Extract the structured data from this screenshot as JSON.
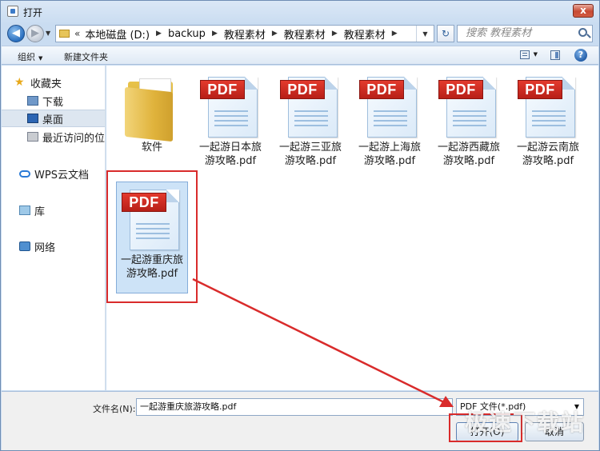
{
  "window": {
    "title": "打开",
    "close_label": "x"
  },
  "address": {
    "overflow": "«",
    "crumbs": [
      "本地磁盘 (D:)",
      "backup",
      "教程素材",
      "教程素材",
      "教程素材"
    ],
    "refresh_label": "↻"
  },
  "search": {
    "placeholder": "搜索 教程素材"
  },
  "toolbar": {
    "organize": "组织",
    "new_folder": "新建文件夹",
    "help": "?"
  },
  "sidebar": {
    "items": [
      {
        "label": "收藏夹",
        "icon": "star-icon"
      },
      {
        "label": "下载",
        "icon": "download-folder-icon"
      },
      {
        "label": "桌面",
        "icon": "desktop-icon"
      },
      {
        "label": "最近访问的位置",
        "icon": "recent-places-icon"
      },
      {
        "label": "WPS云文档",
        "icon": "cloud-icon"
      },
      {
        "label": "库",
        "icon": "library-icon"
      },
      {
        "label": "网络",
        "icon": "network-icon"
      }
    ]
  },
  "files": [
    {
      "name": "软件",
      "type": "folder"
    },
    {
      "name": "一起游日本旅游攻略.pdf",
      "type": "pdf"
    },
    {
      "name": "一起游三亚旅游攻略.pdf",
      "type": "pdf"
    },
    {
      "name": "一起游上海旅游攻略.pdf",
      "type": "pdf"
    },
    {
      "name": "一起游西藏旅游攻略.pdf",
      "type": "pdf"
    },
    {
      "name": "一起游云南旅游攻略.pdf",
      "type": "pdf"
    },
    {
      "name": "一起游重庆旅游攻略.pdf",
      "type": "pdf"
    }
  ],
  "pdf_badge": "PDF",
  "bottom": {
    "filename_label": "文件名(N):",
    "filename_value": "一起游重庆旅游攻略.pdf",
    "filetype_value": "PDF 文件(*.pdf)",
    "open_label": "打开(O)",
    "cancel_label": "取消"
  },
  "watermark": "极速下载站",
  "colors": {
    "annotation": "#d92b2b",
    "selection": "#cde3f7",
    "pdf_red": "#d1271d"
  }
}
